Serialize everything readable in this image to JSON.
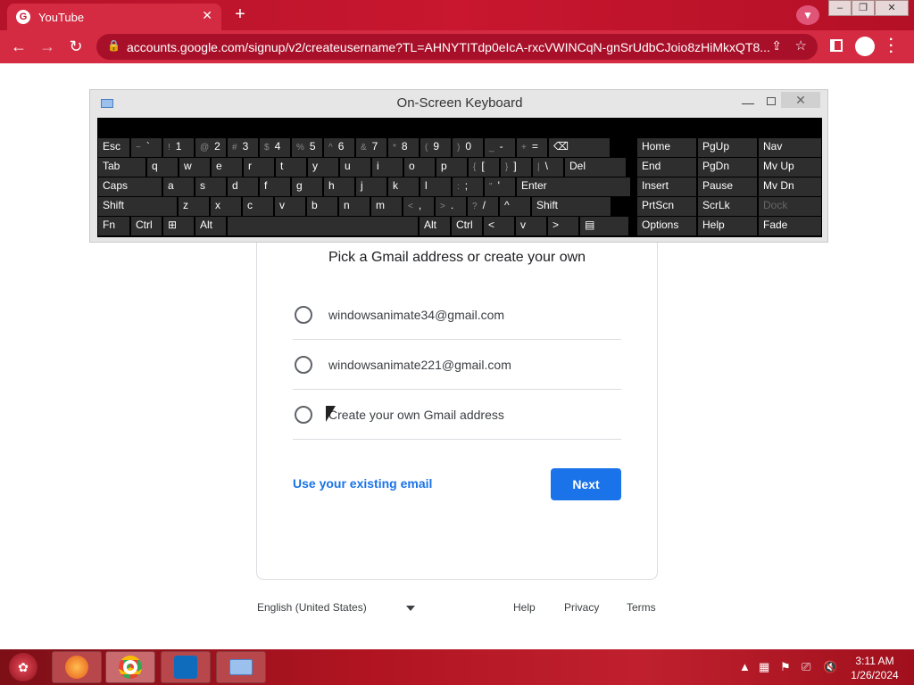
{
  "browser": {
    "tab_title": "YouTube",
    "url": "accounts.google.com/signup/v2/createusername?TL=AHNYTITdp0eIcA-rxcVWINCqN-gnSrUdbCJoio8zHiMkxQT8..."
  },
  "osk": {
    "title": "On-Screen Keyboard",
    "rows": [
      [
        "Esc",
        "~ `",
        "! 1",
        "@ 2",
        "# 3",
        "$ 4",
        "% 5",
        "^ 6",
        "& 7",
        "* 8",
        "( 9",
        ") 0",
        "_ -",
        "+ =",
        "⌫"
      ],
      [
        "Tab",
        "q",
        "w",
        "e",
        "r",
        "t",
        "y",
        "u",
        "i",
        "o",
        "p",
        "{ [",
        "} ]",
        "| \\",
        "Del"
      ],
      [
        "Caps",
        "a",
        "s",
        "d",
        "f",
        "g",
        "h",
        "j",
        "k",
        "l",
        ": ;",
        "\" '",
        "Enter"
      ],
      [
        "Shift",
        "z",
        "x",
        "c",
        "v",
        "b",
        "n",
        "m",
        "< ,",
        "> .",
        "? /",
        "^",
        "Shift"
      ],
      [
        "Fn",
        "Ctrl",
        "⊞",
        "Alt",
        "",
        "Alt",
        "Ctrl",
        "<",
        "v",
        ">",
        "▤"
      ]
    ],
    "nav_keys": [
      [
        "Home",
        "PgUp",
        "Nav"
      ],
      [
        "End",
        "PgDn",
        "Mv Up"
      ],
      [
        "Insert",
        "Pause",
        "Mv Dn"
      ],
      [
        "PrtScn",
        "ScrLk",
        "Dock"
      ],
      [
        "Options",
        "Help",
        "Fade"
      ]
    ]
  },
  "page": {
    "heading": "Pick a Gmail address or create your own",
    "options": [
      "windowsanimate34@gmail.com",
      "windowsanimate221@gmail.com",
      "Create your own Gmail address"
    ],
    "existing_email_link": "Use your existing email",
    "next_button": "Next"
  },
  "footer": {
    "language": "English (United States)",
    "help": "Help",
    "privacy": "Privacy",
    "terms": "Terms"
  },
  "taskbar": {
    "time": "3:11 AM",
    "date": "1/26/2024"
  }
}
